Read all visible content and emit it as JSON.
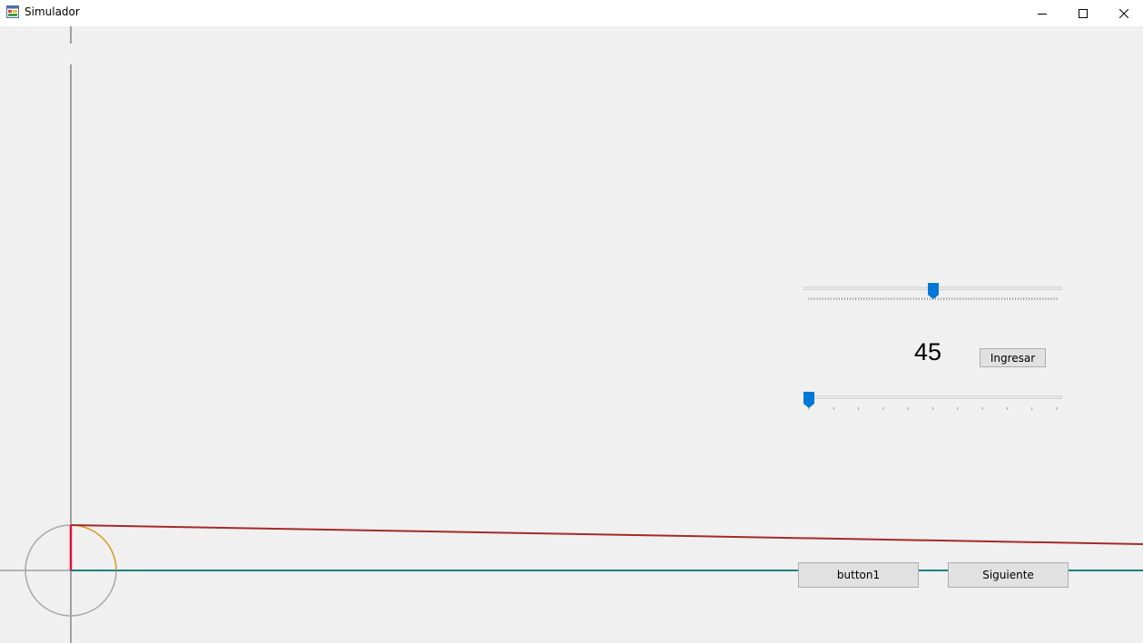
{
  "window": {
    "title": "Simulador",
    "icon": "app-form-icon",
    "controls": {
      "minimize": "minimize-icon",
      "maximize": "maximize-icon",
      "close": "close-icon"
    }
  },
  "controls": {
    "slider_top": {
      "value": 0.5
    },
    "value_label": "45",
    "ingresar_label": "Ingresar",
    "slider_bottom": {
      "value": 0.0
    },
    "button1_label": "button1",
    "siguiente_label": "Siguiente"
  },
  "colors": {
    "axis": "#a0a0a0",
    "teal_line": "#1a8080",
    "red_line": "#a52a2a",
    "radius": "#e0103c",
    "arc": "#e0a020",
    "slider_thumb": "#0078d7"
  }
}
